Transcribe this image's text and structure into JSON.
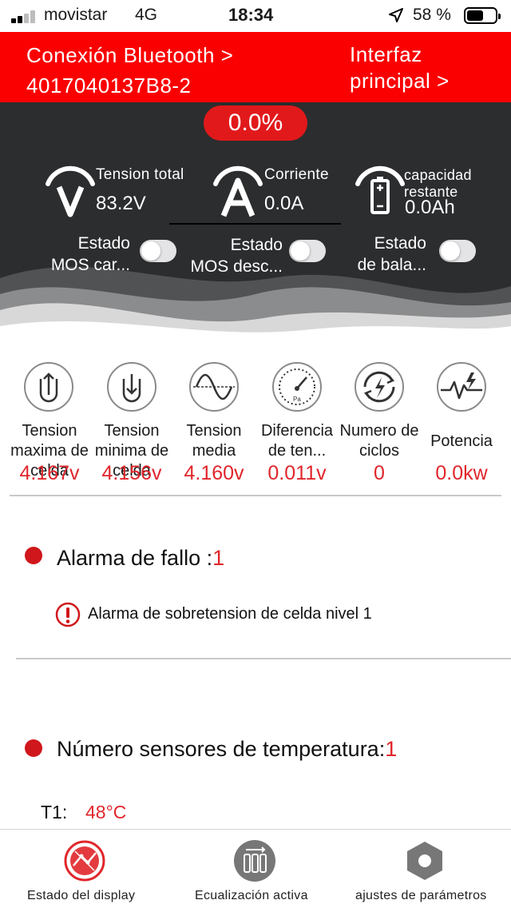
{
  "status_bar": {
    "carrier": "movistar",
    "network": "4G",
    "time": "18:34",
    "battery_percent": "58 %",
    "battery_level": 0.58,
    "signal_bars": 2
  },
  "header": {
    "bluetooth_line1": "Conexión Bluetooth >",
    "bluetooth_line2": "4017040137B8-2",
    "interface_link": "Interfaz principal >"
  },
  "soc": {
    "percent_text": "0.0%"
  },
  "metrics": {
    "voltage": {
      "label": "Tension total",
      "value": "83.2V",
      "icon": "voltage-gauge-icon"
    },
    "current": {
      "label": "Corriente",
      "value": "0.0A",
      "icon": "current-gauge-icon"
    },
    "capacity": {
      "label": "capacidad restante",
      "value": "0.0Ah",
      "icon": "battery-capacity-icon"
    }
  },
  "toggles": [
    {
      "line1": "Estado",
      "line2": "MOS car...",
      "on": false
    },
    {
      "line1": "Estado",
      "line2": "MOS desc...",
      "on": false
    },
    {
      "line1": "Estado",
      "line2": "de bala...",
      "on": false
    }
  ],
  "cell_stats": [
    {
      "label": "Tension maxima de celda",
      "value": "4.167v",
      "icon": "max-voltage-icon"
    },
    {
      "label": "Tension minima de celda",
      "value": "4.156v",
      "icon": "min-voltage-icon"
    },
    {
      "label": "Tension media",
      "value": "4.160v",
      "icon": "sine-wave-icon"
    },
    {
      "label": "Diferencia de ten...",
      "value": "0.011v",
      "icon": "pressure-gauge-icon"
    },
    {
      "label": "Numero de ciclos",
      "value": "0",
      "icon": "cycle-charge-icon"
    },
    {
      "label": "Potencia",
      "value": "0.0kw",
      "icon": "power-pulse-icon"
    }
  ],
  "fault_alarm": {
    "title": "Alarma de fallo :",
    "count": "1",
    "items": [
      "Alarma de sobretension de celda nivel 1"
    ]
  },
  "temperature": {
    "title": "Número sensores de temperatura:",
    "count": "1",
    "sensors": [
      {
        "name": "T1:",
        "value": "48°C"
      }
    ]
  },
  "tabs": [
    {
      "label": "Estado del display",
      "icon": "display-status-icon",
      "active": true
    },
    {
      "label": "Ecualización activa",
      "icon": "active-balance-icon",
      "active": false
    },
    {
      "label": "ajustes de parámetros",
      "icon": "settings-hexagon-icon",
      "active": false
    }
  ],
  "colors": {
    "brand_red": "#fb0000",
    "accent_red": "#e0262b",
    "panel_dark": "#2c2d2f"
  }
}
